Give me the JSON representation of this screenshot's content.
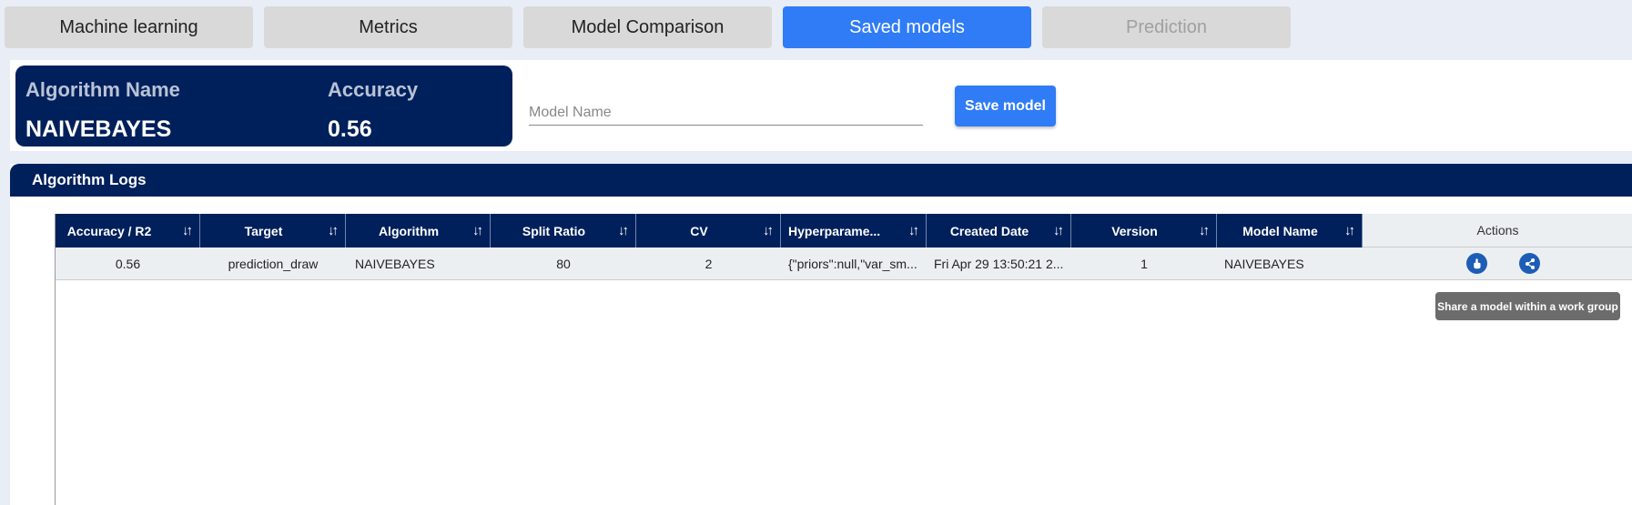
{
  "tabs": [
    {
      "label": "Machine learning"
    },
    {
      "label": "Metrics"
    },
    {
      "label": "Model Comparison"
    },
    {
      "label": "Saved models"
    },
    {
      "label": "Prediction"
    }
  ],
  "summary": {
    "algorithm_label": "Algorithm Name",
    "algorithm_value": "NAIVEBAYES",
    "accuracy_label": "Accuracy",
    "accuracy_value": "0.56"
  },
  "save_form": {
    "model_name_placeholder": "Model Name",
    "model_name_value": "",
    "save_label": "Save model"
  },
  "logs": {
    "title": "Algorithm Logs",
    "columns": [
      "Accuracy / R2",
      "Target",
      "Algorithm",
      "Split Ratio",
      "CV",
      "Hyperparame...",
      "Created Date",
      "Version",
      "Model Name",
      "Actions"
    ],
    "rows": [
      {
        "accuracy": "0.56",
        "target": "prediction_draw",
        "algorithm": "NAIVEBAYES",
        "split_ratio": "80",
        "cv": "2",
        "hyperparameters": "{\"priors\":null,\"var_sm...",
        "created_date": "Fri Apr 29 13:50:21 2...",
        "version": "1",
        "model_name": "NAIVEBAYES"
      }
    ],
    "action_icons": [
      "touch-icon",
      "share-icon"
    ],
    "tooltip": "Share a model within a work group"
  },
  "colors": {
    "accent": "#2f7cf6",
    "navy": "#00205b",
    "action_icon": "#1e5db5"
  }
}
